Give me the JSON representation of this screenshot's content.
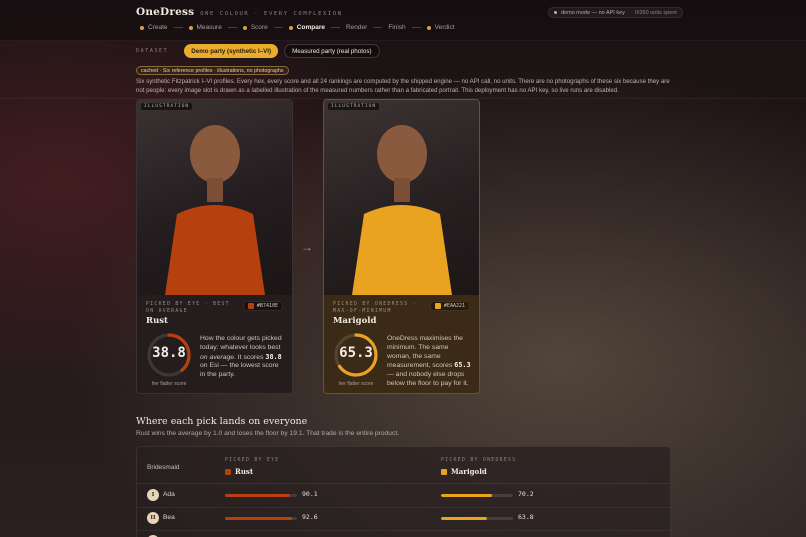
{
  "header": {
    "brand": "OneDress",
    "tagline": "ONE COLOUR · EVERY COMPLEXION",
    "demo_badge": "demo mode — no API key",
    "units": "0/260 units spent",
    "steps": [
      {
        "label": "Create",
        "state": "done"
      },
      {
        "label": "Measure",
        "state": "done"
      },
      {
        "label": "Score",
        "state": "done"
      },
      {
        "label": "Compare",
        "state": "active"
      },
      {
        "label": "Render",
        "state": "todo"
      },
      {
        "label": "Finish",
        "state": "todo"
      },
      {
        "label": "Verdict",
        "state": "todo"
      }
    ]
  },
  "dataset": {
    "label": "DATASET",
    "options": [
      "Demo party (synthetic I–VI)",
      "Measured party (real photos)"
    ],
    "selected": "Demo party (synthetic I–VI)"
  },
  "cached_chip": "cached · Six reference profiles · illustrations, no photographs",
  "intro": "Six synthetic Fitzpatrick I–VI profiles. Every hex, every score and all 24 rankings are computed by the shipped engine — no API call, no units. There are no photographs of these six because they are not people: every image slot is drawn as a labelled illustration of the measured numbers rather than a fabricated portrait. This deployment has no API key, so live runs are disabled.",
  "cards": [
    {
      "tag": "ILLUSTRATION",
      "pick_label": "PICKED BY EYE · BEST ON AVERAGE",
      "name": "Rust",
      "hex": "#B7410E",
      "score": "38.8",
      "score_fraction": 0.388,
      "score_caption": "her flatter score",
      "desc_1": "How the colour gets picked today: whatever looks best ",
      "desc_em": "on average",
      "desc_2": ". It scores ",
      "desc_num": "38.8",
      "desc_3": " on Esi — the lowest score in the party."
    },
    {
      "tag": "ILLUSTRATION",
      "pick_label": "PICKED BY ONEDRESS · MAX-OF-MINIMUM",
      "name": "Marigold",
      "hex": "#EAA221",
      "score": "65.3",
      "score_fraction": 0.653,
      "score_caption": "her flatter score",
      "desc_1": "OneDress maximises the minimum. The same woman, the same measurement, scores ",
      "desc_num": "65.3",
      "desc_2": " — and nobody else drops below the floor to pay for it."
    }
  ],
  "arrow": "→",
  "section": {
    "title": "Where each pick lands on everyone",
    "subtitle": "Rust wins the average by 1.0 and loses the floor by 19.1. That trade is the entire product."
  },
  "table": {
    "bride_header": "Bridesmaid",
    "col_eye_caption": "PICKED BY EYE",
    "col_eye_name": "Rust",
    "col_eye_color": "#B7410E",
    "col_one_caption": "PICKED BY ONEDRESS",
    "col_one_name": "Marigold",
    "col_one_color": "#EAA221",
    "rows": [
      {
        "numeral": "I",
        "name": "Ada",
        "eye": "90.1",
        "eye_frac": 0.901,
        "one": "70.2",
        "one_frac": 0.702
      },
      {
        "numeral": "II",
        "name": "Bea",
        "eye": "92.6",
        "eye_frac": 0.926,
        "one": "63.8",
        "one_frac": 0.638
      }
    ]
  },
  "colors": {
    "accent": "#E9AC2F",
    "rust": "#B7410E",
    "marigold": "#EAA221",
    "skin": "#8A5A3E"
  }
}
